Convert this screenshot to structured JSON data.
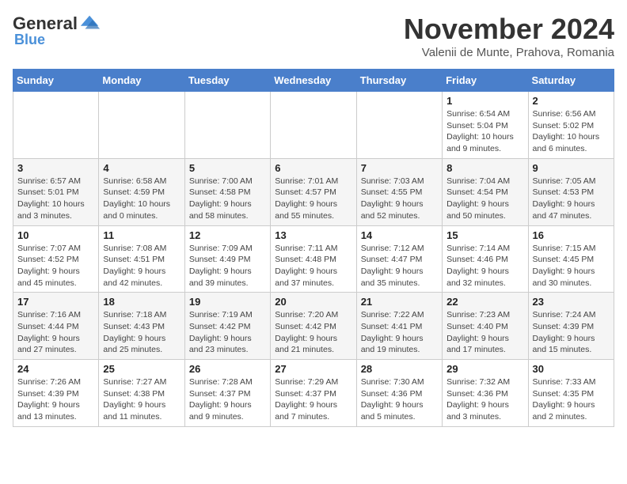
{
  "header": {
    "logo_general": "General",
    "logo_blue": "Blue",
    "month_title": "November 2024",
    "location": "Valenii de Munte, Prahova, Romania"
  },
  "weekdays": [
    "Sunday",
    "Monday",
    "Tuesday",
    "Wednesday",
    "Thursday",
    "Friday",
    "Saturday"
  ],
  "weeks": [
    [
      {
        "day": "",
        "info": ""
      },
      {
        "day": "",
        "info": ""
      },
      {
        "day": "",
        "info": ""
      },
      {
        "day": "",
        "info": ""
      },
      {
        "day": "",
        "info": ""
      },
      {
        "day": "1",
        "info": "Sunrise: 6:54 AM\nSunset: 5:04 PM\nDaylight: 10 hours and 9 minutes."
      },
      {
        "day": "2",
        "info": "Sunrise: 6:56 AM\nSunset: 5:02 PM\nDaylight: 10 hours and 6 minutes."
      }
    ],
    [
      {
        "day": "3",
        "info": "Sunrise: 6:57 AM\nSunset: 5:01 PM\nDaylight: 10 hours and 3 minutes."
      },
      {
        "day": "4",
        "info": "Sunrise: 6:58 AM\nSunset: 4:59 PM\nDaylight: 10 hours and 0 minutes."
      },
      {
        "day": "5",
        "info": "Sunrise: 7:00 AM\nSunset: 4:58 PM\nDaylight: 9 hours and 58 minutes."
      },
      {
        "day": "6",
        "info": "Sunrise: 7:01 AM\nSunset: 4:57 PM\nDaylight: 9 hours and 55 minutes."
      },
      {
        "day": "7",
        "info": "Sunrise: 7:03 AM\nSunset: 4:55 PM\nDaylight: 9 hours and 52 minutes."
      },
      {
        "day": "8",
        "info": "Sunrise: 7:04 AM\nSunset: 4:54 PM\nDaylight: 9 hours and 50 minutes."
      },
      {
        "day": "9",
        "info": "Sunrise: 7:05 AM\nSunset: 4:53 PM\nDaylight: 9 hours and 47 minutes."
      }
    ],
    [
      {
        "day": "10",
        "info": "Sunrise: 7:07 AM\nSunset: 4:52 PM\nDaylight: 9 hours and 45 minutes."
      },
      {
        "day": "11",
        "info": "Sunrise: 7:08 AM\nSunset: 4:51 PM\nDaylight: 9 hours and 42 minutes."
      },
      {
        "day": "12",
        "info": "Sunrise: 7:09 AM\nSunset: 4:49 PM\nDaylight: 9 hours and 39 minutes."
      },
      {
        "day": "13",
        "info": "Sunrise: 7:11 AM\nSunset: 4:48 PM\nDaylight: 9 hours and 37 minutes."
      },
      {
        "day": "14",
        "info": "Sunrise: 7:12 AM\nSunset: 4:47 PM\nDaylight: 9 hours and 35 minutes."
      },
      {
        "day": "15",
        "info": "Sunrise: 7:14 AM\nSunset: 4:46 PM\nDaylight: 9 hours and 32 minutes."
      },
      {
        "day": "16",
        "info": "Sunrise: 7:15 AM\nSunset: 4:45 PM\nDaylight: 9 hours and 30 minutes."
      }
    ],
    [
      {
        "day": "17",
        "info": "Sunrise: 7:16 AM\nSunset: 4:44 PM\nDaylight: 9 hours and 27 minutes."
      },
      {
        "day": "18",
        "info": "Sunrise: 7:18 AM\nSunset: 4:43 PM\nDaylight: 9 hours and 25 minutes."
      },
      {
        "day": "19",
        "info": "Sunrise: 7:19 AM\nSunset: 4:42 PM\nDaylight: 9 hours and 23 minutes."
      },
      {
        "day": "20",
        "info": "Sunrise: 7:20 AM\nSunset: 4:42 PM\nDaylight: 9 hours and 21 minutes."
      },
      {
        "day": "21",
        "info": "Sunrise: 7:22 AM\nSunset: 4:41 PM\nDaylight: 9 hours and 19 minutes."
      },
      {
        "day": "22",
        "info": "Sunrise: 7:23 AM\nSunset: 4:40 PM\nDaylight: 9 hours and 17 minutes."
      },
      {
        "day": "23",
        "info": "Sunrise: 7:24 AM\nSunset: 4:39 PM\nDaylight: 9 hours and 15 minutes."
      }
    ],
    [
      {
        "day": "24",
        "info": "Sunrise: 7:26 AM\nSunset: 4:39 PM\nDaylight: 9 hours and 13 minutes."
      },
      {
        "day": "25",
        "info": "Sunrise: 7:27 AM\nSunset: 4:38 PM\nDaylight: 9 hours and 11 minutes."
      },
      {
        "day": "26",
        "info": "Sunrise: 7:28 AM\nSunset: 4:37 PM\nDaylight: 9 hours and 9 minutes."
      },
      {
        "day": "27",
        "info": "Sunrise: 7:29 AM\nSunset: 4:37 PM\nDaylight: 9 hours and 7 minutes."
      },
      {
        "day": "28",
        "info": "Sunrise: 7:30 AM\nSunset: 4:36 PM\nDaylight: 9 hours and 5 minutes."
      },
      {
        "day": "29",
        "info": "Sunrise: 7:32 AM\nSunset: 4:36 PM\nDaylight: 9 hours and 3 minutes."
      },
      {
        "day": "30",
        "info": "Sunrise: 7:33 AM\nSunset: 4:35 PM\nDaylight: 9 hours and 2 minutes."
      }
    ]
  ]
}
